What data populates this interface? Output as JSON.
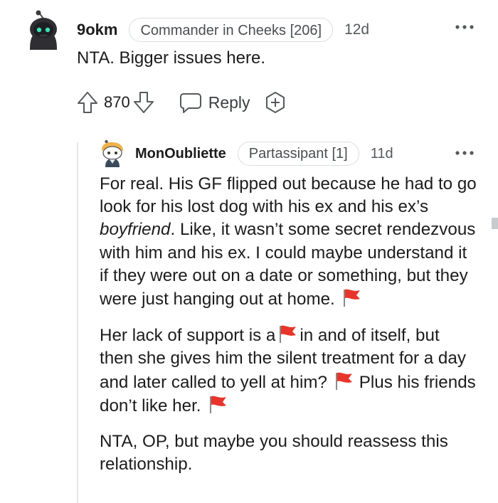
{
  "top_comment": {
    "username": "9okm",
    "flair": "Commander in Cheeks [206]",
    "timestamp": "12d",
    "body": "NTA. Bigger issues here.",
    "score": "870",
    "reply_label": "Reply",
    "icons": {
      "avatar": "snoo-avatar-icon",
      "upvote": "upvote-arrow-icon",
      "downvote": "downvote-arrow-icon",
      "reply": "speech-bubble-icon",
      "award": "award-plus-icon",
      "more": "more-options-icon"
    }
  },
  "reply_comment": {
    "username": "MonOubliette",
    "flair": "Partassipant [1]",
    "timestamp": "11d",
    "paragraph1": {
      "before_italic": "For real. His GF flipped out because he had to go look for his lost dog with his ex and his ex’s ",
      "italic": "boyfriend",
      "after_italic": ". Like, it wasn’t some secret rendezvous with him and his ex. I could maybe understand it if they were out on a date or something, but they were just hanging out at home."
    },
    "paragraph2": {
      "part1": "Her lack of support is a",
      "part2": "in and of itself, but then she gives him the silent treatment for a day and later called to yell at him?",
      "part3": "Plus his friends don’t like her."
    },
    "paragraph3": "NTA, OP, but maybe you should reassess this relationship.",
    "icons": {
      "avatar": "snoo-avatar-icon",
      "flag": "red-flag-emoji-icon",
      "more": "more-options-icon"
    }
  },
  "colors": {
    "text": "#1c1c1c",
    "muted": "#55595c",
    "flair_border": "#d9dee2",
    "thread_line": "#e5e8ea",
    "flag_red": "#e8352b"
  }
}
